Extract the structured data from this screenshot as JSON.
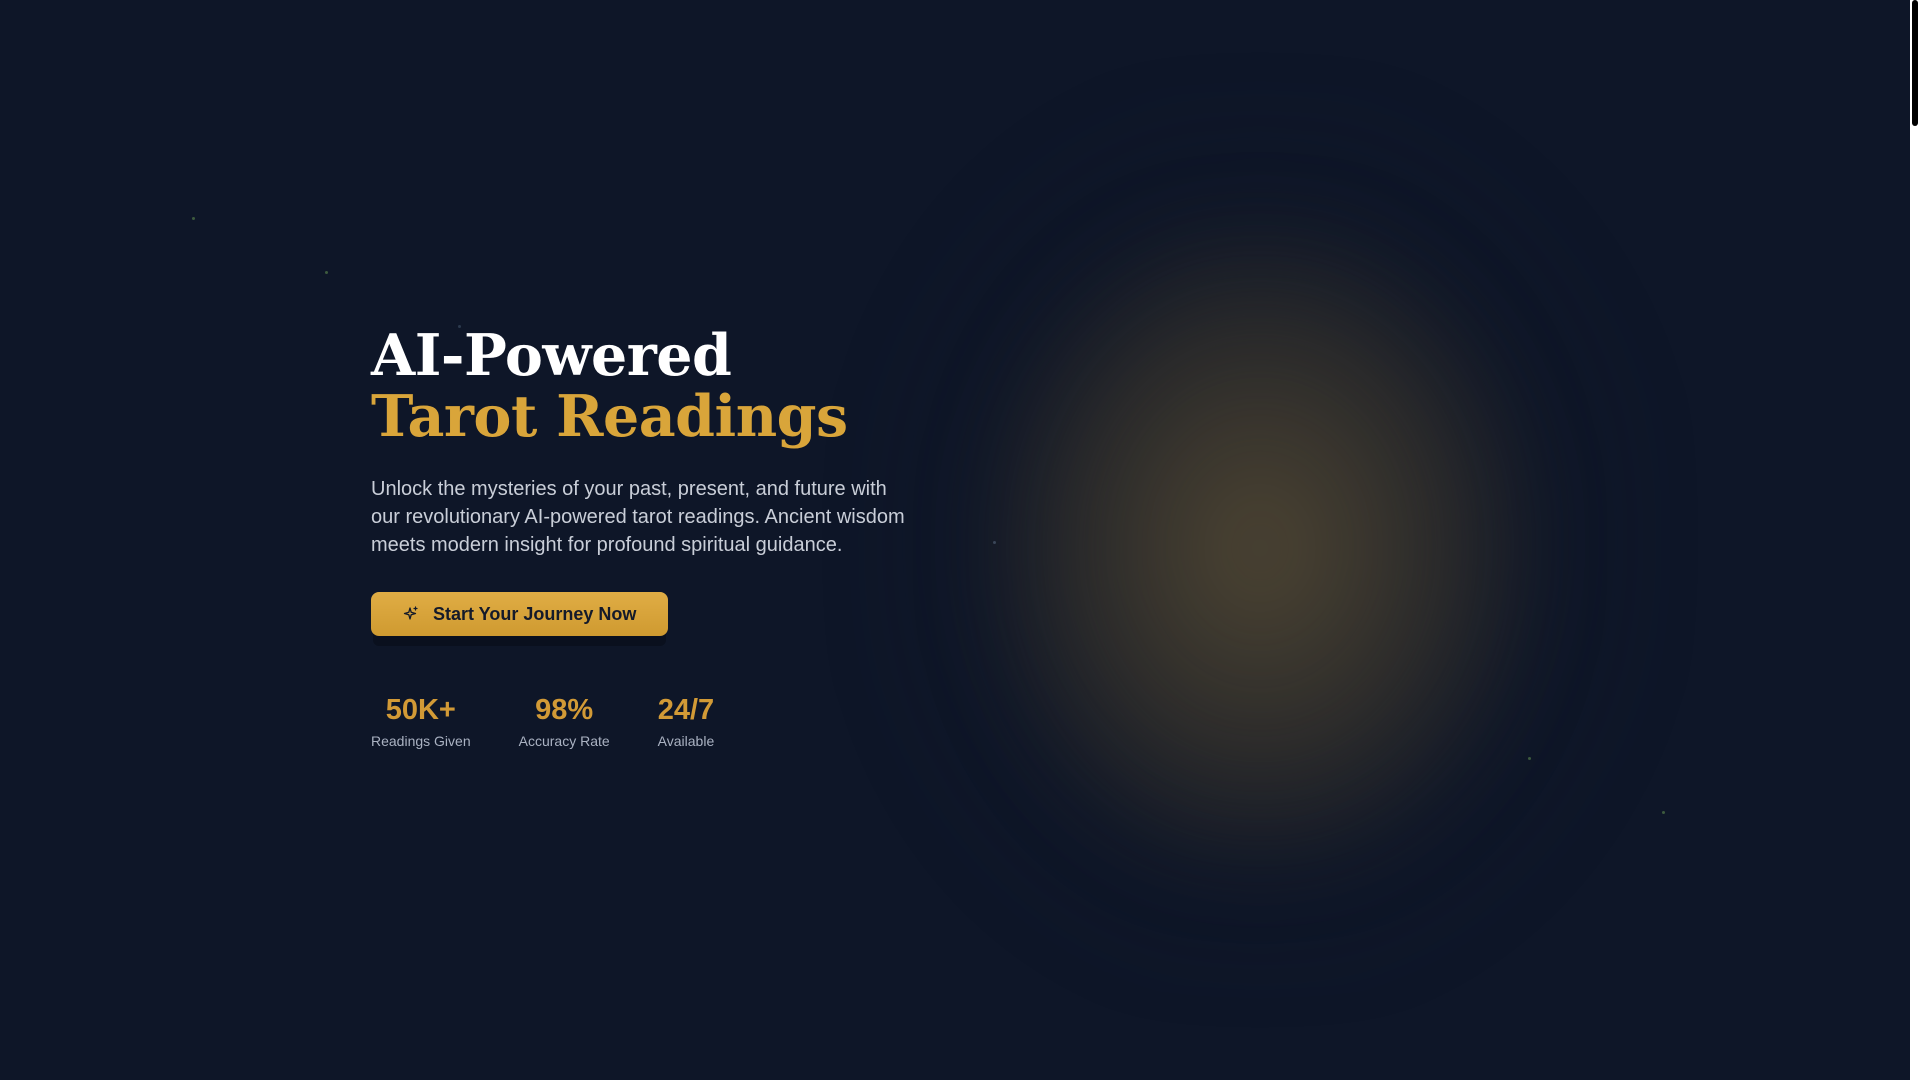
{
  "hero": {
    "title_line1": "AI-Powered",
    "title_line2": "Tarot Readings",
    "subtitle": "Unlock the mysteries of your past, present, and future with our revolutionary AI-powered tarot readings. Ancient wisdom meets modern insight for profound spiritual guidance.",
    "cta_label": "Start Your Journey Now",
    "cta_icon": "sparkle-icon"
  },
  "stats": [
    {
      "value": "50K+",
      "label": "Readings Given"
    },
    {
      "value": "98%",
      "label": "Accuracy Rate"
    },
    {
      "value": "24/7",
      "label": "Available"
    }
  ],
  "colors": {
    "background": "#0e1628",
    "accent_gold": "#d9a53a",
    "text_light": "#c9ced8"
  }
}
